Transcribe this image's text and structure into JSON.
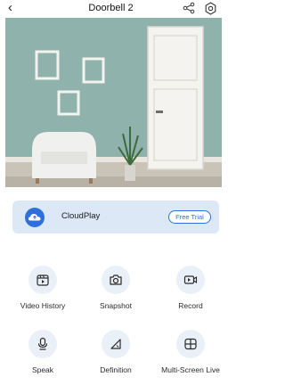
{
  "header": {
    "title": "Doorbell 2",
    "back_icon": "‹"
  },
  "cloud_card": {
    "label": "CloudPlay",
    "button": "Free Trial"
  },
  "actions": [
    {
      "label": "Video History",
      "icon": "video-history-icon"
    },
    {
      "label": "Snapshot",
      "icon": "camera-icon"
    },
    {
      "label": "Record",
      "icon": "record-icon"
    },
    {
      "label": "Speak",
      "icon": "microphone-icon"
    },
    {
      "label": "Definition",
      "icon": "definition-icon"
    },
    {
      "label": "Multi-Screen Live",
      "icon": "multi-screen-icon"
    }
  ],
  "colors": {
    "accent": "#2f6fdc",
    "card_bg": "#dde8f7",
    "icon_bg": "#eaf0f7"
  }
}
